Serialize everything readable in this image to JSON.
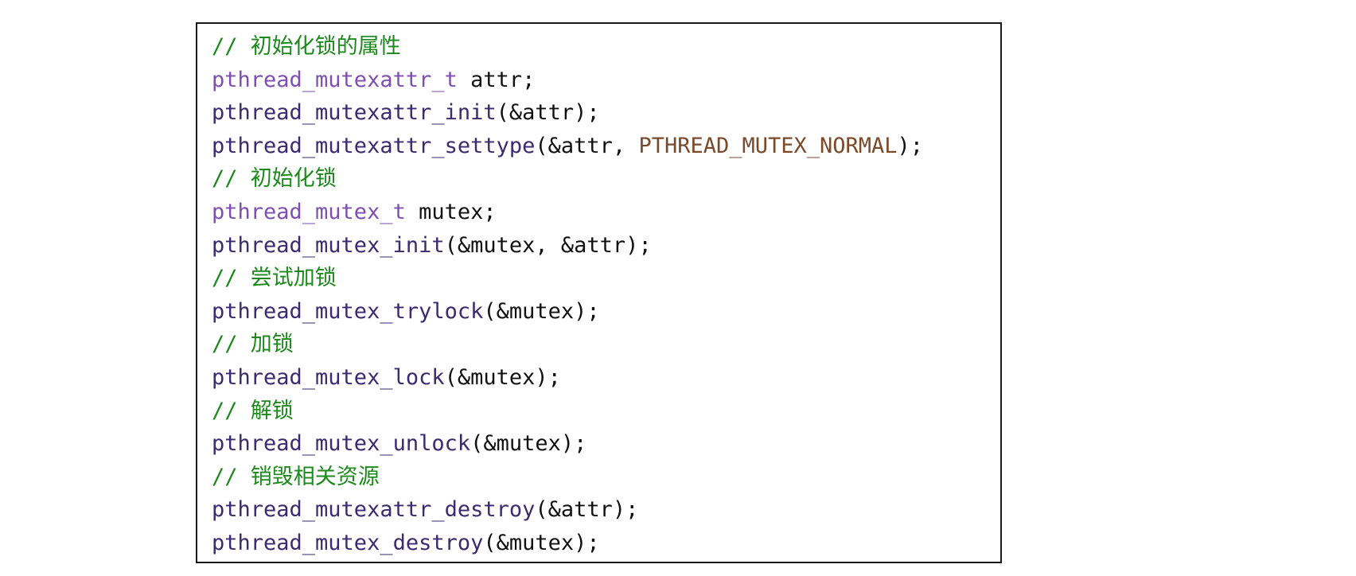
{
  "colors": {
    "comment": "#1b8a1b",
    "type": "#7e4fb0",
    "function": "#3a2a70",
    "constant": "#7a4a2a",
    "plain": "#111111",
    "border": "#1a1a1a"
  },
  "code_lines": [
    {
      "kind": "comment",
      "tokens": [
        {
          "cls": "comment",
          "text": "// 初始化锁的属性"
        }
      ]
    },
    {
      "kind": "code",
      "tokens": [
        {
          "cls": "type",
          "text": "pthread_mutexattr_t"
        },
        {
          "cls": "plain",
          "text": " attr;"
        }
      ]
    },
    {
      "kind": "code",
      "tokens": [
        {
          "cls": "func",
          "text": "pthread_mutexattr_init"
        },
        {
          "cls": "plain",
          "text": "(&attr);"
        }
      ]
    },
    {
      "kind": "code",
      "tokens": [
        {
          "cls": "func",
          "text": "pthread_mutexattr_settype"
        },
        {
          "cls": "plain",
          "text": "(&attr, "
        },
        {
          "cls": "const",
          "text": "PTHREAD_MUTEX_NORMAL"
        },
        {
          "cls": "plain",
          "text": ");"
        }
      ]
    },
    {
      "kind": "comment",
      "tokens": [
        {
          "cls": "comment",
          "text": "// 初始化锁"
        }
      ]
    },
    {
      "kind": "code",
      "tokens": [
        {
          "cls": "type",
          "text": "pthread_mutex_t"
        },
        {
          "cls": "plain",
          "text": " mutex;"
        }
      ]
    },
    {
      "kind": "code",
      "tokens": [
        {
          "cls": "func",
          "text": "pthread_mutex_init"
        },
        {
          "cls": "plain",
          "text": "(&mutex, &attr);"
        }
      ]
    },
    {
      "kind": "comment",
      "tokens": [
        {
          "cls": "comment",
          "text": "// 尝试加锁"
        }
      ]
    },
    {
      "kind": "code",
      "tokens": [
        {
          "cls": "func",
          "text": "pthread_mutex_trylock"
        },
        {
          "cls": "plain",
          "text": "(&mutex);"
        }
      ]
    },
    {
      "kind": "comment",
      "tokens": [
        {
          "cls": "comment",
          "text": "// 加锁"
        }
      ]
    },
    {
      "kind": "code",
      "tokens": [
        {
          "cls": "func",
          "text": "pthread_mutex_lock"
        },
        {
          "cls": "plain",
          "text": "(&mutex);"
        }
      ]
    },
    {
      "kind": "comment",
      "tokens": [
        {
          "cls": "comment",
          "text": "// 解锁"
        }
      ]
    },
    {
      "kind": "code",
      "tokens": [
        {
          "cls": "func",
          "text": "pthread_mutex_unlock"
        },
        {
          "cls": "plain",
          "text": "(&mutex);"
        }
      ]
    },
    {
      "kind": "comment",
      "tokens": [
        {
          "cls": "comment",
          "text": "// 销毁相关资源"
        }
      ]
    },
    {
      "kind": "code",
      "tokens": [
        {
          "cls": "func",
          "text": "pthread_mutexattr_destroy"
        },
        {
          "cls": "plain",
          "text": "(&attr);"
        }
      ]
    },
    {
      "kind": "code",
      "tokens": [
        {
          "cls": "func",
          "text": "pthread_mutex_destroy"
        },
        {
          "cls": "plain",
          "text": "(&mutex);"
        }
      ]
    }
  ]
}
